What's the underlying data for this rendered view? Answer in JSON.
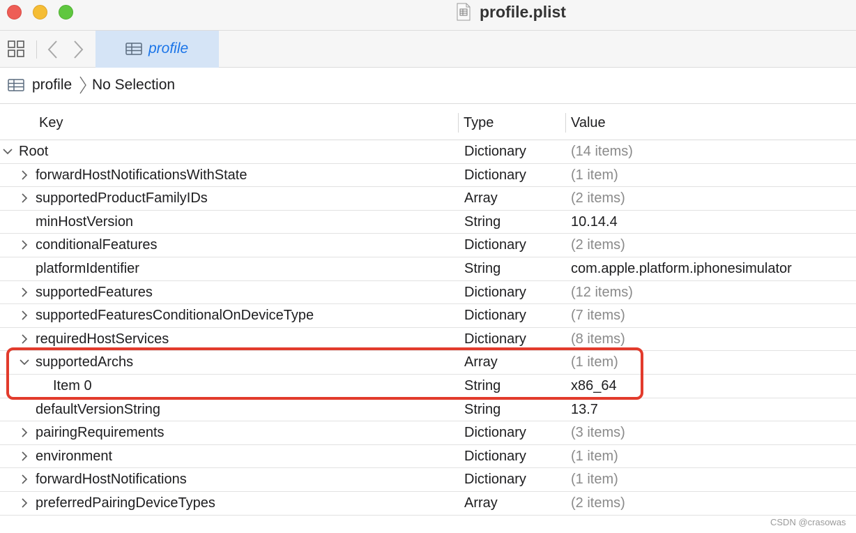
{
  "window": {
    "title": "profile.plist",
    "traffic_lights": {
      "close": "#ee5d56",
      "minimize": "#f5bd35",
      "maximize": "#5fc73f"
    }
  },
  "toolbar": {
    "active_tab_label": "profile",
    "accent_color": "#1a74e8",
    "tab_bg": "#d5e4f6"
  },
  "breadcrumb": {
    "root": "profile",
    "selection": "No Selection"
  },
  "table": {
    "columns": [
      "Key",
      "Type",
      "Value"
    ],
    "rows": [
      {
        "key": "Root",
        "type": "Dictionary",
        "value": "(14 items)",
        "disclosure": "expanded",
        "indent": 0,
        "muted": true
      },
      {
        "key": "forwardHostNotificationsWithState",
        "type": "Dictionary",
        "value": "(1 item)",
        "disclosure": "collapsed",
        "indent": 1,
        "muted": true
      },
      {
        "key": "supportedProductFamilyIDs",
        "type": "Array",
        "value": "(2 items)",
        "disclosure": "collapsed",
        "indent": 1,
        "muted": true
      },
      {
        "key": "minHostVersion",
        "type": "String",
        "value": "10.14.4",
        "disclosure": "none",
        "indent": 1,
        "muted": false
      },
      {
        "key": "conditionalFeatures",
        "type": "Dictionary",
        "value": "(2 items)",
        "disclosure": "collapsed",
        "indent": 1,
        "muted": true
      },
      {
        "key": "platformIdentifier",
        "type": "String",
        "value": "com.apple.platform.iphonesimulator",
        "disclosure": "none",
        "indent": 1,
        "muted": false
      },
      {
        "key": "supportedFeatures",
        "type": "Dictionary",
        "value": "(12 items)",
        "disclosure": "collapsed",
        "indent": 1,
        "muted": true
      },
      {
        "key": "supportedFeaturesConditionalOnDeviceType",
        "type": "Dictionary",
        "value": "(7 items)",
        "disclosure": "collapsed",
        "indent": 1,
        "muted": true
      },
      {
        "key": "requiredHostServices",
        "type": "Dictionary",
        "value": "(8 items)",
        "disclosure": "collapsed",
        "indent": 1,
        "muted": true
      },
      {
        "key": "supportedArchs",
        "type": "Array",
        "value": "(1 item)",
        "disclosure": "expanded",
        "indent": 1,
        "muted": true
      },
      {
        "key": "Item 0",
        "type": "String",
        "value": "x86_64",
        "disclosure": "none",
        "indent": 2,
        "muted": false
      },
      {
        "key": "defaultVersionString",
        "type": "String",
        "value": "13.7",
        "disclosure": "none",
        "indent": 1,
        "muted": false
      },
      {
        "key": "pairingRequirements",
        "type": "Dictionary",
        "value": "(3 items)",
        "disclosure": "collapsed",
        "indent": 1,
        "muted": true
      },
      {
        "key": "environment",
        "type": "Dictionary",
        "value": "(1 item)",
        "disclosure": "collapsed",
        "indent": 1,
        "muted": true
      },
      {
        "key": "forwardHostNotifications",
        "type": "Dictionary",
        "value": "(1 item)",
        "disclosure": "collapsed",
        "indent": 1,
        "muted": true
      },
      {
        "key": "preferredPairingDeviceTypes",
        "type": "Array",
        "value": "(2 items)",
        "disclosure": "collapsed",
        "indent": 1,
        "muted": true
      }
    ]
  },
  "annotation": {
    "color": "#e23b2c"
  },
  "watermark": "CSDN @crasowas"
}
